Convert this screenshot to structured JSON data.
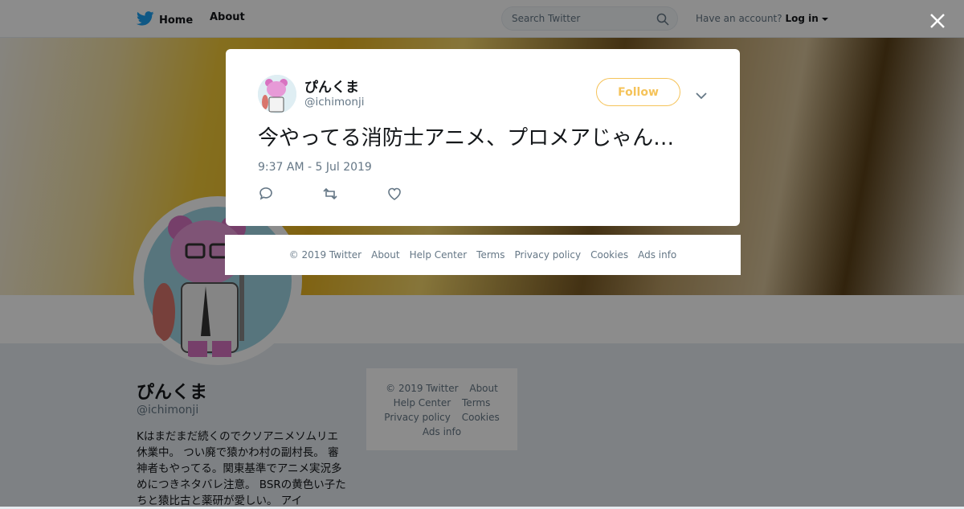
{
  "topbar": {
    "home_label": "Home",
    "about_label": "About",
    "search_placeholder": "Search Twitter",
    "account_prompt": "Have an account?",
    "login_label": "Log in"
  },
  "profile": {
    "name": "ぴんくま",
    "handle": "@ichimonji",
    "bio": "Kはまだまだ続くのでクソアニメソムリエ休業中。 つい廃で猿かわ村の副村長。 審神者もやってる。関東基準でアニメ実況多めにつきネタバレ注意。 BSRの黄色い子たちと猿比古と薬研が愛しい。 アイ"
  },
  "sidebar_footer": {
    "row1": [
      "© 2019 Twitter",
      "About"
    ],
    "row2": [
      "Help Center",
      "Terms"
    ],
    "row3": [
      "Privacy policy",
      "Cookies"
    ],
    "row4": [
      "Ads info"
    ]
  },
  "tweet": {
    "name": "ぴんくま",
    "handle": "@ichimonji",
    "follow_label": "Follow",
    "text": "今やってる消防士アニメ、プロメアじゃん…",
    "timestamp": "9:37 AM - 5 Jul 2019"
  },
  "modal_footer": {
    "items": [
      "© 2019 Twitter",
      "About",
      "Help Center",
      "Terms",
      "Privacy policy",
      "Cookies",
      "Ads info"
    ]
  },
  "colors": {
    "brand_blue": "#1da1f2",
    "follow_accent": "#f5c35a",
    "muted_text": "#657786"
  },
  "icons": [
    "twitter-bird-icon",
    "home-icon",
    "search-icon",
    "caret-down-icon",
    "chevron-down-icon",
    "reply-icon",
    "retweet-icon",
    "like-icon",
    "close-icon"
  ]
}
